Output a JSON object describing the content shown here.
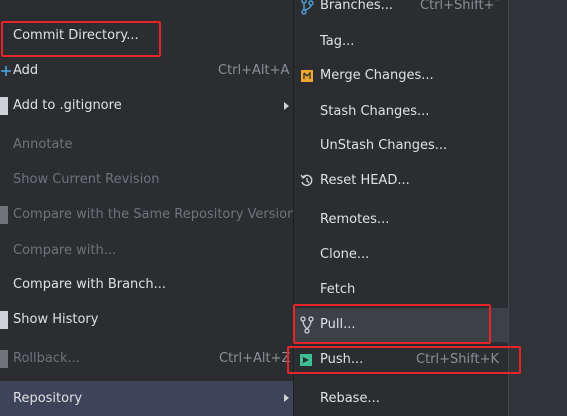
{
  "colors": {
    "menu_bg": "#2b2d30",
    "text": "#dfe1e5",
    "disabled_text": "#6f737a",
    "shortcut_text": "#8c8f96",
    "selected_bg": "#3d4358",
    "highlight_border": "#e5242a",
    "add_icon": "#4fa3e0",
    "merge_icon": "#f0a732",
    "push_icon": "#3fbf91"
  },
  "left_menu": {
    "items": [
      {
        "label": "Commit Directory...",
        "state": "normal"
      },
      {
        "label": "Add",
        "shortcut": "Ctrl+Alt+A",
        "icon": "plus-icon"
      },
      {
        "label": "Add to .gitignore",
        "submenu": true
      },
      {
        "label": "Annotate",
        "state": "disabled"
      },
      {
        "label": "Show Current Revision",
        "state": "disabled"
      },
      {
        "label": "Compare with the Same Repository Version",
        "state": "disabled"
      },
      {
        "label": "Compare with...",
        "state": "disabled"
      },
      {
        "label": "Compare with Branch..."
      },
      {
        "label": "Show History"
      },
      {
        "label": "Rollback...",
        "shortcut": "Ctrl+Alt+Z",
        "state": "disabled"
      },
      {
        "label": "Repository",
        "submenu": true,
        "state": "selected"
      }
    ]
  },
  "right_menu": {
    "items": [
      {
        "label": "Branches...",
        "shortcut": "Ctrl+Shift+`",
        "icon": "branch-icon"
      },
      {
        "label": "Tag..."
      },
      {
        "label": "Merge Changes...",
        "icon": "merge-icon"
      },
      {
        "label": "Stash Changes..."
      },
      {
        "label": "UnStash Changes..."
      },
      {
        "label": "Reset HEAD...",
        "icon": "reset-icon"
      },
      {
        "label": "Remotes..."
      },
      {
        "label": "Clone..."
      },
      {
        "label": "Fetch"
      },
      {
        "label": "Pull...",
        "icon": "pull-icon",
        "state": "hover"
      },
      {
        "label": "Push...",
        "shortcut": "Ctrl+Shift+K",
        "icon": "push-icon"
      },
      {
        "label": "Rebase..."
      }
    ]
  }
}
